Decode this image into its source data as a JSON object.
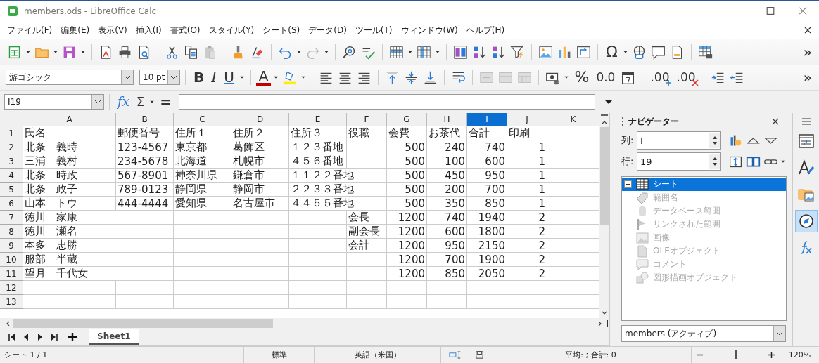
{
  "window": {
    "title": "members.ods - LibreOffice Calc"
  },
  "menu": [
    "ファイル(F)",
    "編集(E)",
    "表示(V)",
    "挿入(I)",
    "書式(O)",
    "スタイル(Y)",
    "シート(S)",
    "データ(D)",
    "ツール(T)",
    "ウィンドウ(W)",
    "ヘルプ(H)"
  ],
  "standard_toolbar": {
    "special_character": "Ω",
    "more": "»"
  },
  "formatting_toolbar": {
    "font_name": "游ゴシック",
    "font_size": "10 pt",
    "bold": "B",
    "italic": "I",
    "underline": "U",
    "font_color": "A",
    "percent": "%",
    "number_format": "0.0",
    "add_decimal": ".00",
    "delete_decimal": ".00",
    "more": "»"
  },
  "formula_bar": {
    "cell_reference": "I19",
    "function_wizard": "fx",
    "sum": "Σ",
    "formula": "="
  },
  "sheet": {
    "columns": [
      {
        "label": "A",
        "selected": false,
        "right_aligned": false,
        "page_break": false
      },
      {
        "label": "B",
        "selected": false,
        "right_aligned": false,
        "page_break": false
      },
      {
        "label": "C",
        "selected": false,
        "right_aligned": false,
        "page_break": false
      },
      {
        "label": "D",
        "selected": false,
        "right_aligned": false,
        "page_break": false
      },
      {
        "label": "E",
        "selected": false,
        "right_aligned": false,
        "page_break": false
      },
      {
        "label": "F",
        "selected": false,
        "right_aligned": false,
        "page_break": false
      },
      {
        "label": "G",
        "selected": false,
        "right_aligned": true,
        "page_break": false
      },
      {
        "label": "H",
        "selected": false,
        "right_aligned": true,
        "page_break": false
      },
      {
        "label": "I",
        "selected": true,
        "right_aligned": true,
        "page_break": true
      },
      {
        "label": "J",
        "selected": false,
        "right_aligned": true,
        "page_break": false
      },
      {
        "label": "K",
        "selected": false,
        "page_break": false
      }
    ],
    "rows": [
      {
        "label": "1",
        "kind": "header",
        "cells": [
          "氏名",
          "郵便番号",
          "住所１",
          "住所２",
          "住所３",
          "役職",
          "会費",
          "お茶代",
          "合計",
          "印刷",
          null
        ]
      },
      {
        "label": "2",
        "kind": "data",
        "cells": [
          "北条　義時",
          "123-4567",
          "東京都",
          "葛飾区",
          "１２３番地",
          null,
          "500",
          "240",
          "740",
          "1",
          null
        ]
      },
      {
        "label": "3",
        "kind": "data",
        "cells": [
          "三浦　義村",
          "234-5678",
          "北海道",
          "札幌市",
          "４５６番地",
          null,
          "500",
          "100",
          "600",
          "1",
          null
        ]
      },
      {
        "label": "4",
        "kind": "data",
        "cells": [
          "北条　時政",
          "567-8901",
          "神奈川県",
          "鎌倉市",
          "１１２２番地",
          null,
          "500",
          "450",
          "950",
          "1",
          null
        ]
      },
      {
        "label": "5",
        "kind": "data",
        "cells": [
          "北条　政子",
          "789-0123",
          "静岡県",
          "静岡市",
          "２２３３番地",
          null,
          "500",
          "200",
          "700",
          "1",
          null
        ]
      },
      {
        "label": "6",
        "kind": "data",
        "cells": [
          "山本　トウ",
          "444-4444",
          "愛知県",
          "名古屋市",
          "４４５５番地",
          null,
          "500",
          "350",
          "850",
          "1",
          null
        ]
      },
      {
        "label": "7",
        "kind": "data",
        "cells": [
          "徳川　家康",
          null,
          null,
          null,
          null,
          "会長",
          "1200",
          "740",
          "1940",
          "2",
          null
        ]
      },
      {
        "label": "8",
        "kind": "data",
        "cells": [
          "徳川　瀬名",
          null,
          null,
          null,
          null,
          "副会長",
          "1200",
          "600",
          "1800",
          "2",
          null
        ]
      },
      {
        "label": "9",
        "kind": "data",
        "cells": [
          "本多　忠勝",
          null,
          null,
          null,
          null,
          "会計",
          "1200",
          "950",
          "2150",
          "2",
          null
        ]
      },
      {
        "label": "10",
        "kind": "data",
        "cells": [
          "服部　半蔵",
          null,
          null,
          null,
          null,
          null,
          "1200",
          "700",
          "1900",
          "2",
          null
        ]
      },
      {
        "label": "11",
        "kind": "data",
        "cells": [
          "望月　千代女",
          null,
          null,
          null,
          null,
          null,
          "1200",
          "850",
          "2050",
          "2",
          null
        ]
      },
      {
        "label": "12",
        "kind": "data",
        "cells": [
          null,
          null,
          null,
          null,
          null,
          null,
          null,
          null,
          null,
          null,
          null
        ]
      },
      {
        "label": "13",
        "kind": "data",
        "cells": [
          null,
          null,
          null,
          null,
          null,
          null,
          null,
          null,
          null,
          null,
          null
        ]
      }
    ],
    "tabs": [
      {
        "label": "Sheet1",
        "selected": true
      }
    ]
  },
  "navigator": {
    "title": "ナビゲーター",
    "column_label": "列:",
    "column_value": "I",
    "row_label": "行:",
    "row_value": "19",
    "items": [
      {
        "label": "シート",
        "selected": true,
        "disabled": false,
        "expanded": false
      },
      {
        "label": "範囲名",
        "selected": false,
        "disabled": true
      },
      {
        "label": "データベース範囲",
        "selected": false,
        "disabled": true
      },
      {
        "label": "リンクされた範囲",
        "selected": false,
        "disabled": true
      },
      {
        "label": "画像",
        "selected": false,
        "disabled": true
      },
      {
        "label": "OLEオブジェクト",
        "selected": false,
        "disabled": true
      },
      {
        "label": "コメント",
        "selected": false,
        "disabled": true
      },
      {
        "label": "図形描画オブジェクト",
        "selected": false,
        "disabled": true
      }
    ],
    "document": "members (アクティブ)"
  },
  "sidebar_decks": [
    {
      "selected": false
    },
    {
      "selected": false
    },
    {
      "selected": false
    },
    {
      "selected": true
    },
    {
      "selected": false
    }
  ],
  "status_bar": {
    "sheet": "シート 1 / 1",
    "page_style": "標準",
    "language": "英語（米国）",
    "summary": "平均: ; 合計: 0",
    "zoom_slider": {
      "level": 0.5
    },
    "zoom": "120%"
  }
}
